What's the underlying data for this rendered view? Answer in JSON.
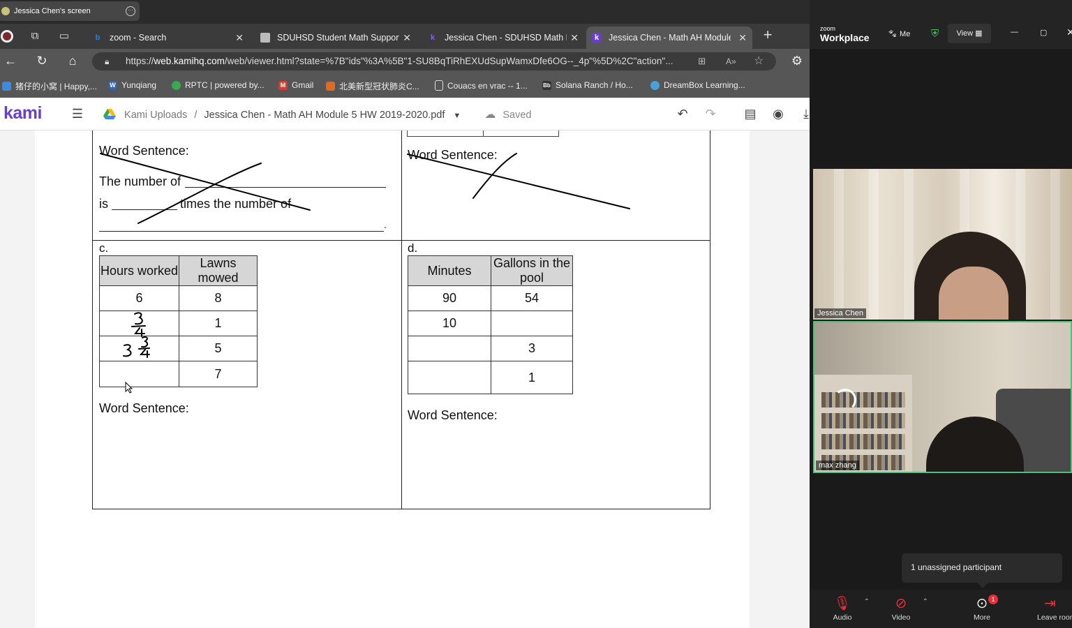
{
  "share": {
    "label": "Jessica Chen's screen"
  },
  "browser": {
    "tabs": [
      {
        "label": "zoom - Search",
        "icon": "bing-icon"
      },
      {
        "label": "SDUHSD Student Math Support |",
        "icon": "page-icon"
      },
      {
        "label": "Jessica Chen - SDUHSD Math BH",
        "icon": "kami-icon"
      },
      {
        "label": "Jessica Chen - Math AH Module",
        "icon": "kami-icon"
      }
    ],
    "new_tab": "+",
    "url_host_prefix": "https://",
    "url_host": "web.kamihq.com",
    "url_rest": "/web/viewer.html?state=%7B\"ids\"%3A%5B\"1-SU8BqTiRhEXUdSupWamxDfe6OG--_4p\"%5D%2C\"action\"...",
    "bookmarks": [
      "猪仔的小窝 | Happy,...",
      "Yunqiang",
      "RPTC | powered by...",
      "Gmail",
      "北美新型冠状肺炎C...",
      "Couacs en vrac -- 1...",
      "Solana Ranch / Ho...",
      "DreamBox Learning..."
    ]
  },
  "kami": {
    "logo": "kami",
    "crumb": "Kami Uploads",
    "sep": "/",
    "doc_title": "Jessica Chen - Math AH Module 5 HW 2019-2020.pdf",
    "saved": "Saved"
  },
  "worksheet": {
    "b_word_sentence": "Word Sentence:",
    "b_number_of": "The number of",
    "b_is": "is",
    "b_times": "times the number of",
    "b_period": ".",
    "b2_word_sentence": "Word Sentence:",
    "c_label": "c.",
    "d_label": "d.",
    "c_table": {
      "headers": [
        "Hours worked",
        "Lawns mowed"
      ],
      "rows": [
        [
          "6",
          "8"
        ],
        [
          "",
          "1"
        ],
        [
          "",
          "5"
        ],
        [
          "",
          "7"
        ]
      ]
    },
    "d_table": {
      "headers": [
        "Minutes",
        "Gallons in the pool"
      ],
      "rows": [
        [
          "90",
          "54"
        ],
        [
          "10",
          ""
        ],
        [
          "",
          "3"
        ],
        [
          "",
          "1"
        ]
      ]
    },
    "c_word_sentence": "Word Sentence:",
    "d_word_sentence": "Word Sentence:"
  },
  "zoom": {
    "logo_small": "zoom",
    "logo_big": "Workplace",
    "me": "Me",
    "view": "View",
    "participants": [
      {
        "name": "Jessica Chen"
      },
      {
        "name": "max zhang"
      }
    ],
    "tooltip": "1 unassigned participant",
    "controls": {
      "audio": "Audio",
      "video": "Video",
      "more": "More",
      "more_badge": "1",
      "leave": "Leave room"
    }
  }
}
